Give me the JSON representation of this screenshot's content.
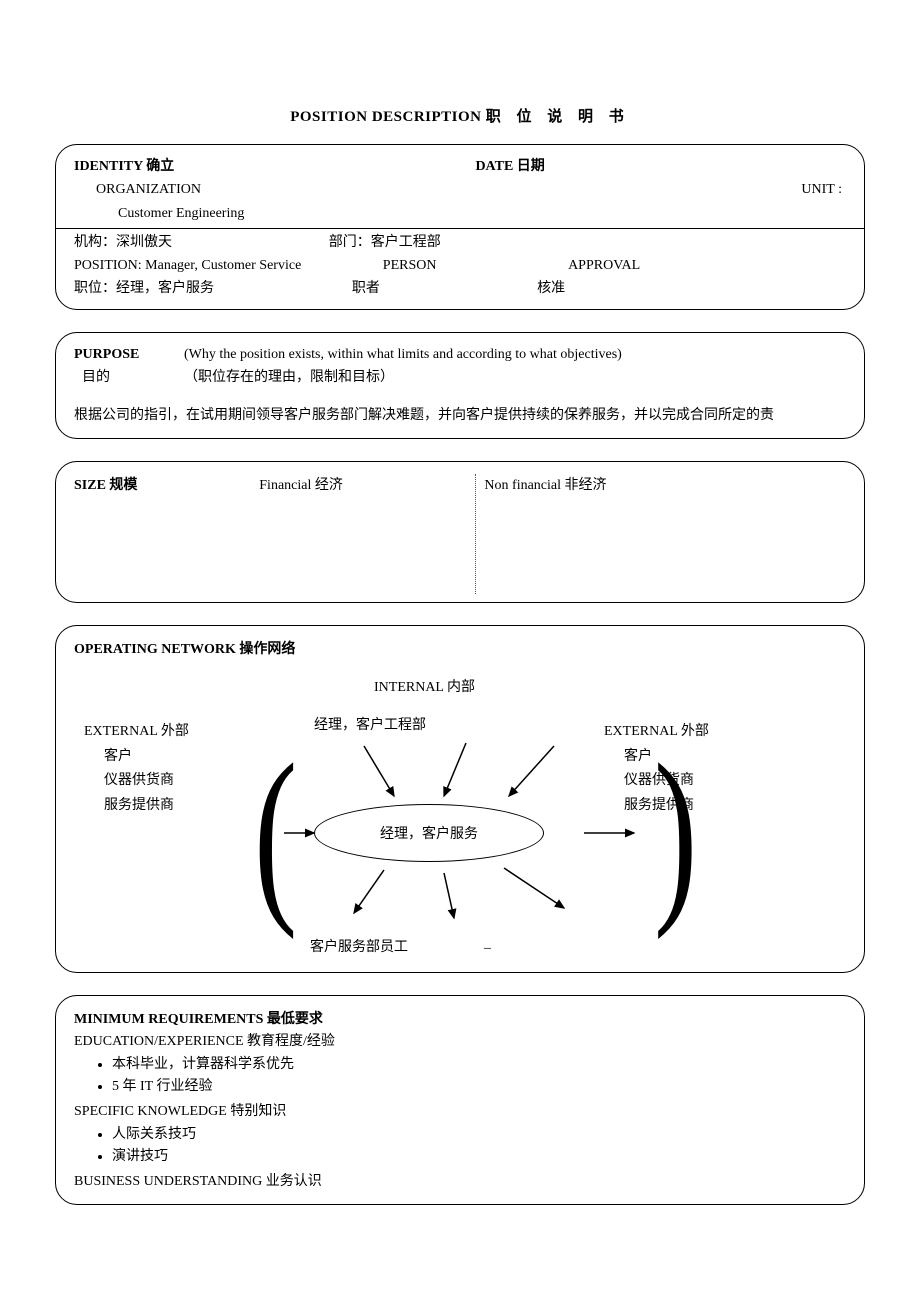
{
  "title_en": "POSITION DESCRIPTION",
  "title_zh": "职 位 说 明 书",
  "identity": {
    "heading": "IDENTITY  确立",
    "date_label": "DATE  日期",
    "org_label": "ORGANIZATION",
    "unit_label": "UNIT :",
    "org_value": "Customer Engineering",
    "org_zh_label": "机构：深圳傲天",
    "dept_zh": "部门：客户工程部",
    "position_label": "POSITION: Manager, Customer Service",
    "person_label": "PERSON",
    "approval_label": "APPROVAL",
    "position_zh": "职位：经理，客户服务",
    "person_zh": "职者",
    "approval_zh": "核准"
  },
  "purpose": {
    "heading": "PURPOSE",
    "sub_en": "(Why the position exists,    within what limits and according to what objectives)",
    "heading_zh": "目的",
    "sub_zh": "（职位存在的理由，限制和目标）",
    "body": "根据公司的指引，在试用期间领导客户服务部门解决难题，并向客户提供持续的保养服务，并以完成合同所定的责"
  },
  "size": {
    "heading": "SIZE  规模",
    "financial": "Financial  经济",
    "nonfinancial": "Non financial  非经济"
  },
  "opnet": {
    "heading": "OPERATING NETWORK  操作网络",
    "internal": "INTERNAL  内部",
    "external": "EXTERNAL  外部",
    "ext_items": [
      "客户",
      "仪器供货商",
      "服务提供商"
    ],
    "internal_top": "经理，客户工程部",
    "center": "经理，客户服务",
    "internal_bottom": "客户服务部员工",
    "dash": "_"
  },
  "minreq": {
    "heading": "MINIMUM REQUIREMENTS  最低要求",
    "edu_label": "EDUCATION/EXPERIENCE  教育程度/经验",
    "edu_items": [
      "本科毕业，计算器科学系优先",
      "5 年 IT 行业经验"
    ],
    "knowledge_label": "SPECIFIC KNOWLEDGE  特别知识",
    "knowledge_items": [
      "人际关系技巧",
      "演讲技巧"
    ],
    "business_label": "BUSINESS UNDERSTANDING  业务认识"
  }
}
